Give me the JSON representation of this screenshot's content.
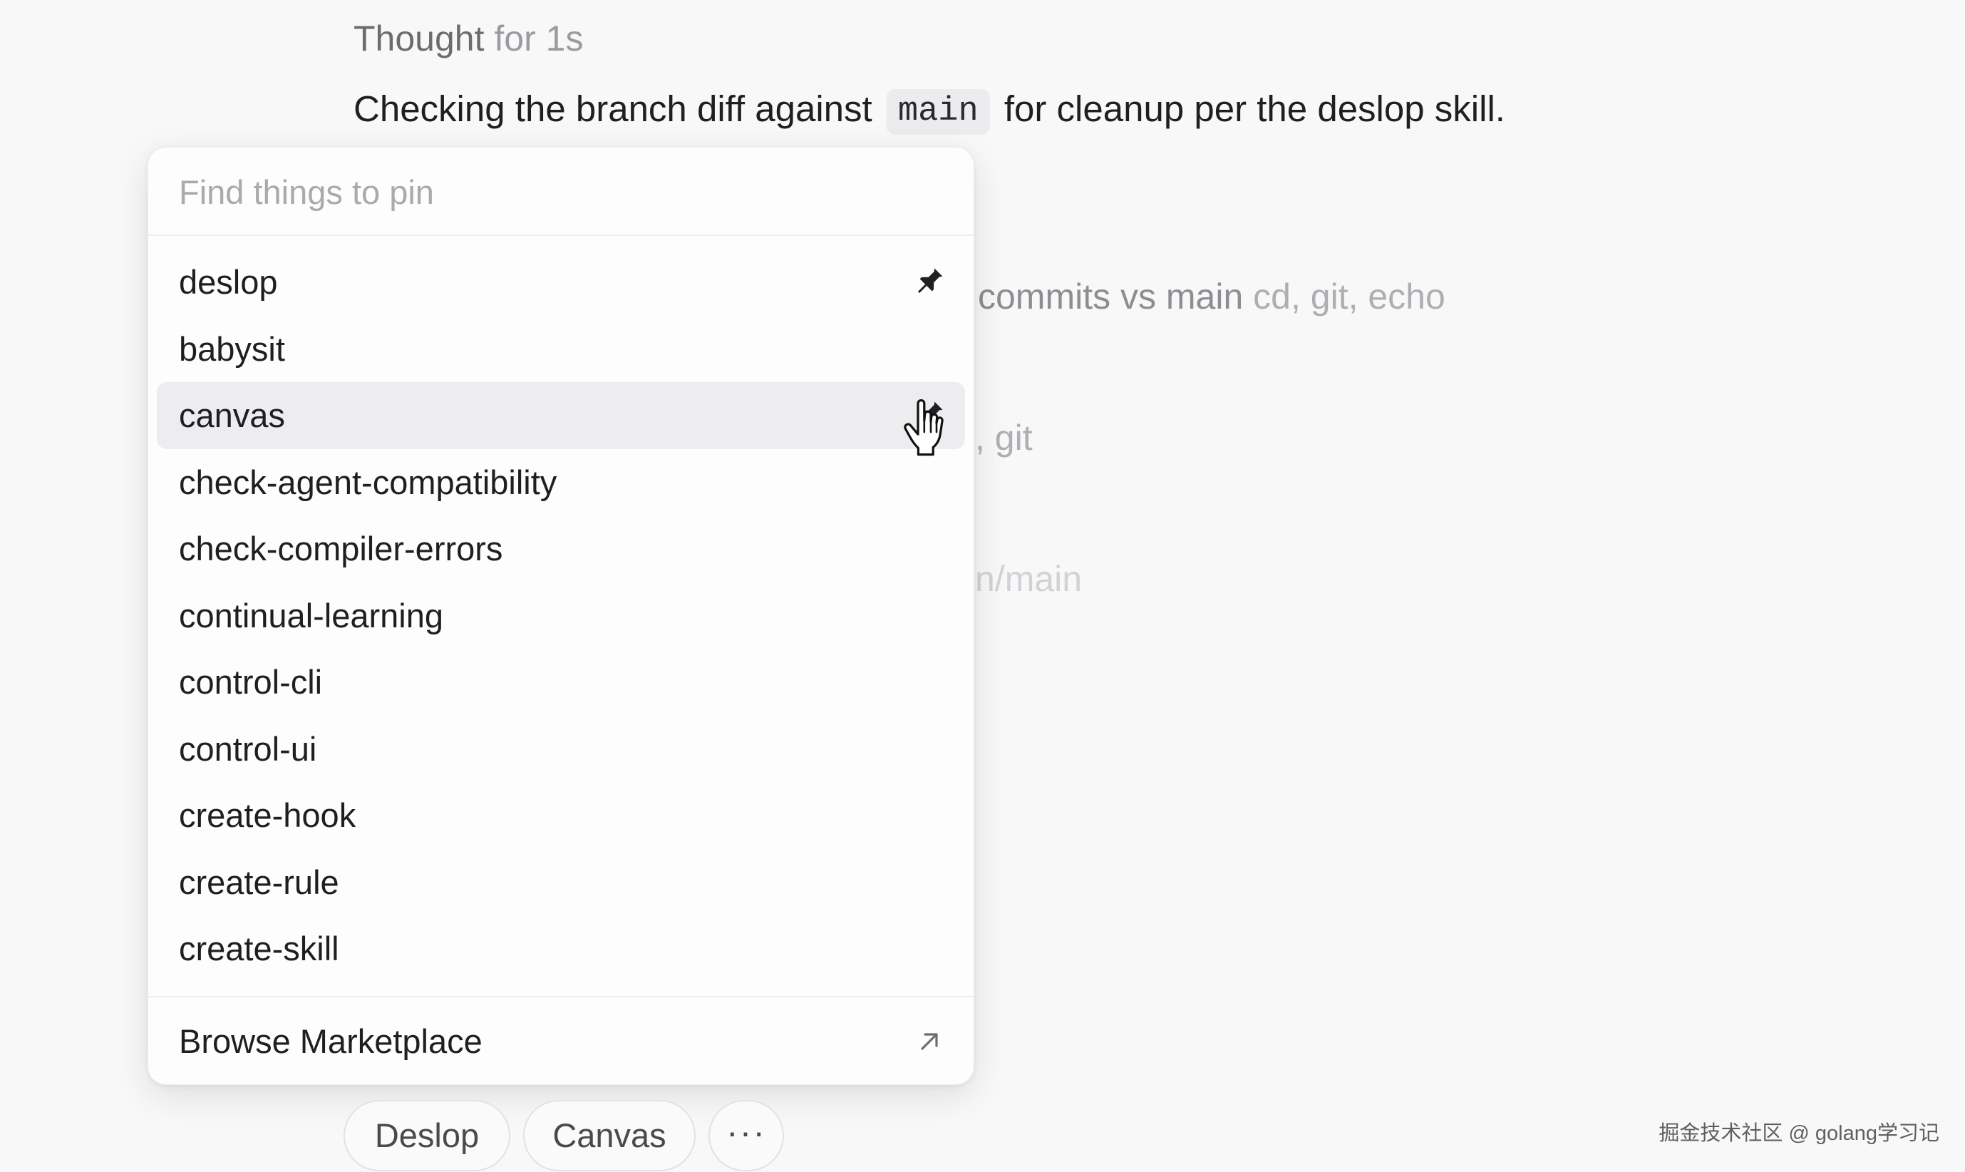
{
  "thought": {
    "label": "Thought",
    "duration": "for 1s"
  },
  "message": {
    "before": "Checking the branch diff against",
    "code": "main",
    "after": "for cleanup per the deslop skill."
  },
  "background_steps": [
    {
      "text": "commits vs main",
      "tools": "cd, git, echo"
    },
    {
      "text": ", git",
      "tools": ""
    },
    {
      "text": "n/main",
      "tools": ""
    }
  ],
  "popover": {
    "search": {
      "placeholder": "Find things to pin",
      "value": ""
    },
    "items": [
      {
        "label": "deslop",
        "pinned": true,
        "hovered": false
      },
      {
        "label": "babysit",
        "pinned": false,
        "hovered": false
      },
      {
        "label": "canvas",
        "pinned": true,
        "hovered": true
      },
      {
        "label": "check-agent-compatibility",
        "pinned": false,
        "hovered": false
      },
      {
        "label": "check-compiler-errors",
        "pinned": false,
        "hovered": false
      },
      {
        "label": "continual-learning",
        "pinned": false,
        "hovered": false
      },
      {
        "label": "control-cli",
        "pinned": false,
        "hovered": false
      },
      {
        "label": "control-ui",
        "pinned": false,
        "hovered": false
      },
      {
        "label": "create-hook",
        "pinned": false,
        "hovered": false
      },
      {
        "label": "create-rule",
        "pinned": false,
        "hovered": false
      },
      {
        "label": "create-skill",
        "pinned": false,
        "hovered": false
      }
    ],
    "footer": {
      "label": "Browse Marketplace",
      "icon": "external-arrow-icon"
    }
  },
  "pinned_chips": [
    {
      "label": "Deslop"
    },
    {
      "label": "Canvas"
    },
    {
      "label": "···"
    }
  ],
  "watermark": "掘金技术社区 @ golang学习记",
  "colors": {
    "background": "#f8f8f9",
    "popover_bg": "#fdfdfd",
    "hover_row": "#ededef",
    "text_primary": "#1f1f21",
    "text_muted": "#9a9aa0"
  }
}
